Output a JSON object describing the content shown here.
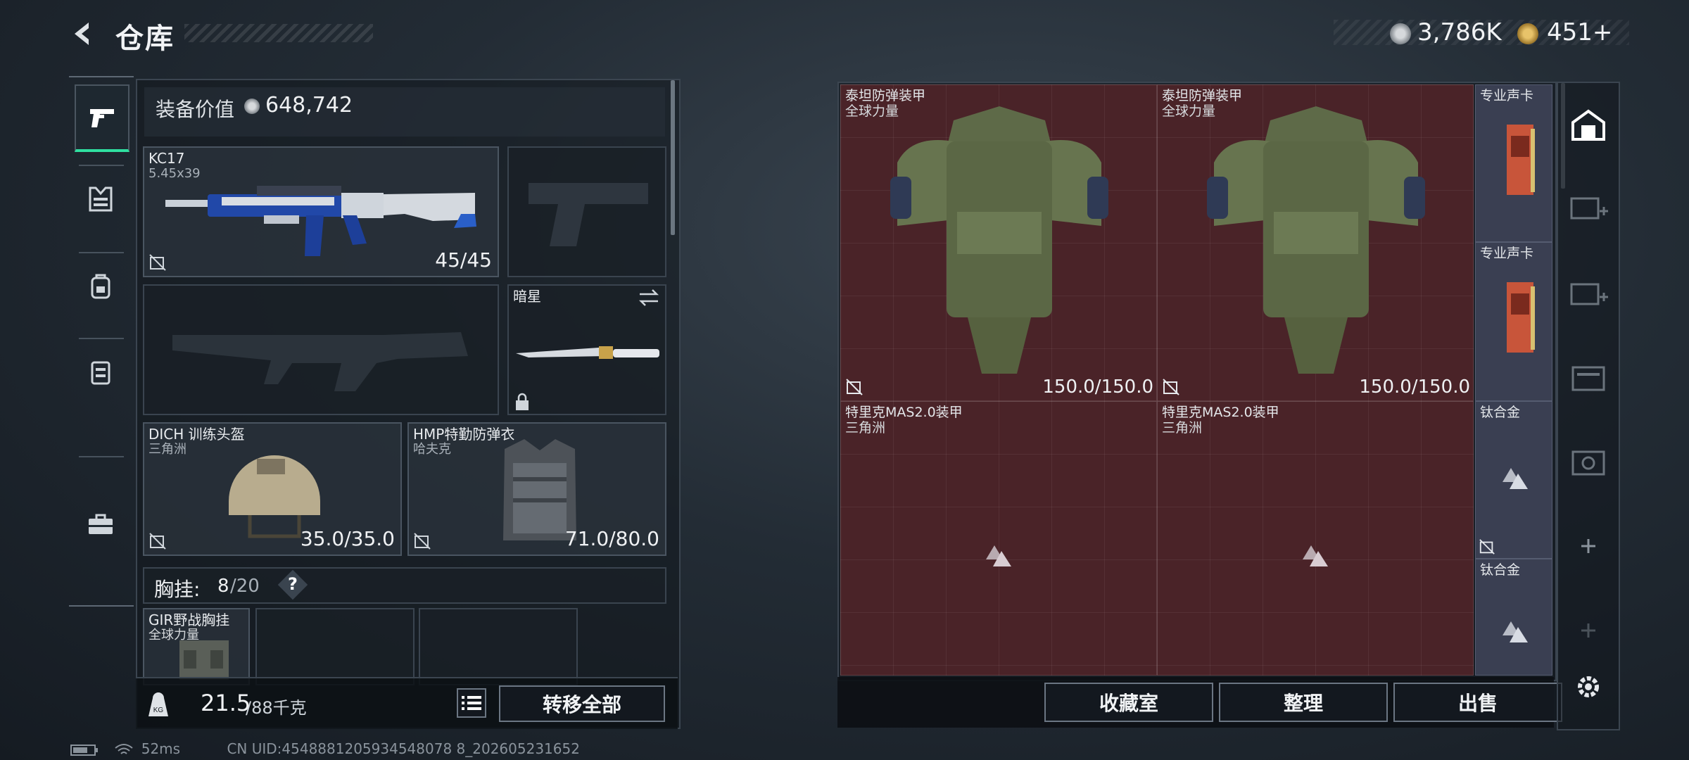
{
  "header": {
    "title": "仓库",
    "currency_silver": "3,786K",
    "currency_gold": "451+"
  },
  "nav": {
    "items": [
      "weapons-icon",
      "armor-icon",
      "backpack-icon",
      "rig-icon",
      "case-icon"
    ]
  },
  "loadout": {
    "value_label": "装备价值",
    "value": "648,742",
    "primary": {
      "name": "KC17",
      "caliber": "5.45x39",
      "ammo": "45/45"
    },
    "melee": {
      "name": "暗星"
    },
    "helmet": {
      "name": "DICH 训练头盔",
      "faction": "三角洲",
      "durability": "35.0/35.0"
    },
    "vest": {
      "name": "HMP特勤防弹衣",
      "faction": "哈夫克",
      "durability": "71.0/80.0"
    },
    "rig_label": "胸挂:",
    "rig_used": "8",
    "rig_total": "/20",
    "rig_help": "?",
    "rig_item": {
      "name": "GIR野战胸挂",
      "faction": "全球力量"
    },
    "weight": "21.5",
    "weight_max": "/88千克",
    "transfer_all": "转移全部"
  },
  "stash": {
    "items": [
      {
        "name": "泰坦防弹装甲",
        "faction": "全球力量",
        "durability": "150.0/150.0"
      },
      {
        "name": "泰坦防弹装甲",
        "faction": "全球力量",
        "durability": "150.0/150.0"
      },
      {
        "name": "特里克MAS2.0装甲",
        "faction": "三角洲"
      },
      {
        "name": "特里克MAS2.0装甲",
        "faction": "三角洲"
      }
    ],
    "minis": [
      {
        "name": "专业声卡"
      },
      {
        "name": "专业声卡"
      },
      {
        "name": "钛合金"
      },
      {
        "name": "钛合金"
      }
    ],
    "buttons": {
      "collection": "收藏室",
      "sort": "整理",
      "sell": "出售"
    }
  },
  "status": {
    "ping": "52ms",
    "uid": "CN UID:4548881205934548078 8_202605231652"
  },
  "colors": {
    "accent": "#2fe0a0",
    "stash_red": "#4a2328",
    "mini_slot": "#3a3f52"
  }
}
